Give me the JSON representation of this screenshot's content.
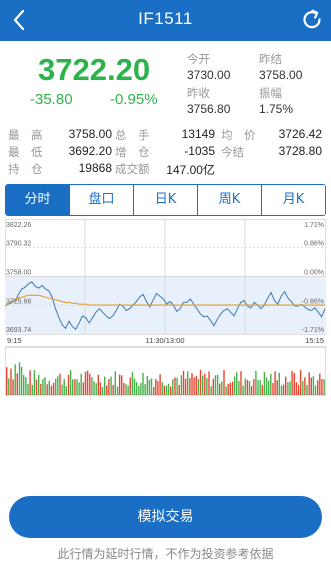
{
  "header": {
    "title": "IF1511",
    "back_icon": "chevron-left-icon",
    "refresh_icon": "refresh-icon"
  },
  "quote": {
    "price": "3722.20",
    "change": "-35.80",
    "change_pct": "-0.95%",
    "today_open_label": "今开",
    "today_open": "3730.00",
    "prev_settle_label": "昨结",
    "prev_settle": "3758.00",
    "prev_close_label": "昨收",
    "prev_close": "3756.80",
    "amplitude_label": "振幅",
    "amplitude": "1.75%"
  },
  "stats": {
    "high_label": "最　高",
    "high": "3758.00",
    "total_label": "总　手",
    "total": "13149",
    "avg_label": "均　价",
    "avg": "3726.42",
    "low_label": "最　低",
    "low": "3692.20",
    "incr_label": "增　仓",
    "incr": "-1035",
    "settle_label": "今结",
    "settle": "3728.80",
    "oi_label": "持　仓",
    "oi": "19868",
    "turnover_label": "成交额",
    "turnover": "147.00亿"
  },
  "tabs": [
    "分时",
    "盘口",
    "日K",
    "周K",
    "月K"
  ],
  "chart_data": {
    "type": "line",
    "price_axis_left": [
      "3822.26",
      "3790.32",
      "3758.00",
      "3725.68",
      "3693.74"
    ],
    "price_axis_right": [
      "1.71%",
      "0.86%",
      "0.00%",
      "-0.86%",
      "-1.71%"
    ],
    "time_labels": [
      "9:15",
      "11:30/13:00",
      "15:15"
    ],
    "volume_max_label": "316.00",
    "ylim": [
      3693.74,
      3822.26
    ],
    "series": [
      {
        "values": [
          3725,
          3727,
          3729,
          3731,
          3738,
          3744,
          3746,
          3750,
          3752,
          3747,
          3745,
          3748,
          3744,
          3742,
          3735,
          3722,
          3712,
          3704,
          3700,
          3708,
          3702,
          3699,
          3706,
          3714,
          3712,
          3706,
          3712,
          3718,
          3722,
          3718,
          3714,
          3711,
          3714,
          3720,
          3727,
          3725,
          3720,
          3722,
          3726,
          3730,
          3735,
          3738,
          3730,
          3724,
          3732,
          3739,
          3736,
          3733,
          3727,
          3730,
          3726,
          3719,
          3722,
          3729,
          3729,
          3733,
          3727,
          3722,
          3716,
          3713,
          3714,
          3709,
          3703,
          3710,
          3716,
          3720,
          3722,
          3718,
          3714,
          3722,
          3729,
          3731,
          3725,
          3723,
          3729,
          3726,
          3722,
          3726,
          3734,
          3740,
          3731,
          3727,
          3736,
          3741,
          3734,
          3730,
          3725,
          3725,
          3727,
          3724,
          3721,
          3720,
          3723,
          3718,
          3713,
          3722
        ]
      },
      {
        "values": [
          3725,
          3728,
          3731,
          3733,
          3734,
          3735,
          3736,
          3737,
          3737,
          3737,
          3737,
          3736,
          3735,
          3734,
          3733,
          3732,
          3731,
          3730,
          3729,
          3729,
          3728,
          3728,
          3727,
          3727,
          3727,
          3726,
          3726,
          3726,
          3726,
          3726,
          3726,
          3726,
          3726,
          3726,
          3726,
          3726,
          3726,
          3726,
          3726,
          3726,
          3726,
          3726,
          3726,
          3726,
          3726,
          3726,
          3726,
          3726,
          3726,
          3726,
          3726,
          3726,
          3726,
          3726,
          3726,
          3726,
          3726,
          3726,
          3726,
          3726,
          3726,
          3726,
          3726,
          3726,
          3726,
          3726,
          3726,
          3726,
          3726,
          3726,
          3726,
          3726,
          3726,
          3726,
          3726,
          3726,
          3726,
          3726,
          3726,
          3726,
          3726,
          3726,
          3726,
          3726,
          3726,
          3726,
          3726,
          3726,
          3726,
          3726,
          3726,
          3726,
          3726,
          3726,
          3726,
          3726
        ]
      }
    ]
  },
  "actions": {
    "simulate_trade": "模拟交易"
  },
  "footer": {
    "disclaimer": "此行情为延时行情，不作为投资参考依据"
  }
}
